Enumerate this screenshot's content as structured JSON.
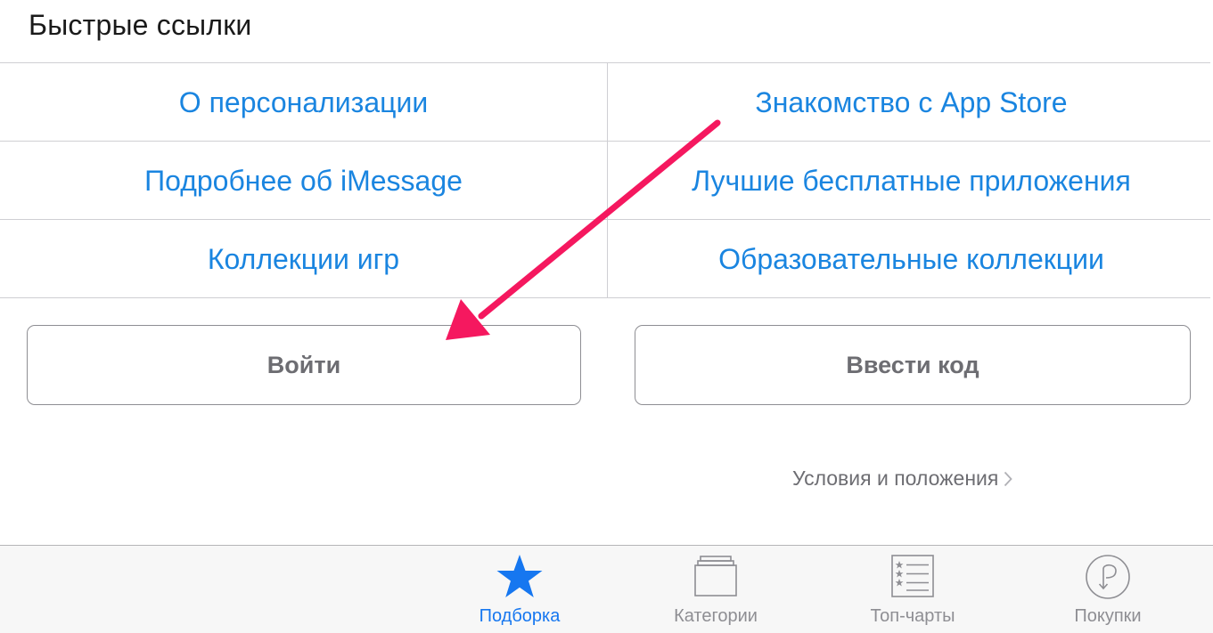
{
  "section": {
    "title": "Быстрые ссылки"
  },
  "quick_links": [
    {
      "label": "О персонализации"
    },
    {
      "label": "Знакомство с App Store"
    },
    {
      "label": "Подробнее об iMessage"
    },
    {
      "label": "Лучшие бесплатные приложения"
    },
    {
      "label": "Коллекции игр"
    },
    {
      "label": "Образовательные коллекции"
    }
  ],
  "buttons": {
    "sign_in": "Войти",
    "redeem_code": "Ввести код"
  },
  "terms": {
    "label": "Условия и положения"
  },
  "tabbar": {
    "tabs": [
      {
        "label": "Подборка",
        "icon": "star-icon",
        "active": true
      },
      {
        "label": "Категории",
        "icon": "categories-icon",
        "active": false
      },
      {
        "label": "Топ-чарты",
        "icon": "top-charts-icon",
        "active": false
      },
      {
        "label": "Покупки",
        "icon": "purchased-icon",
        "active": false
      }
    ]
  },
  "colors": {
    "link": "#1a85e0",
    "active_tab": "#1677f0",
    "inactive_tab": "#8e8e93",
    "annotation_arrow": "#f5185f"
  }
}
